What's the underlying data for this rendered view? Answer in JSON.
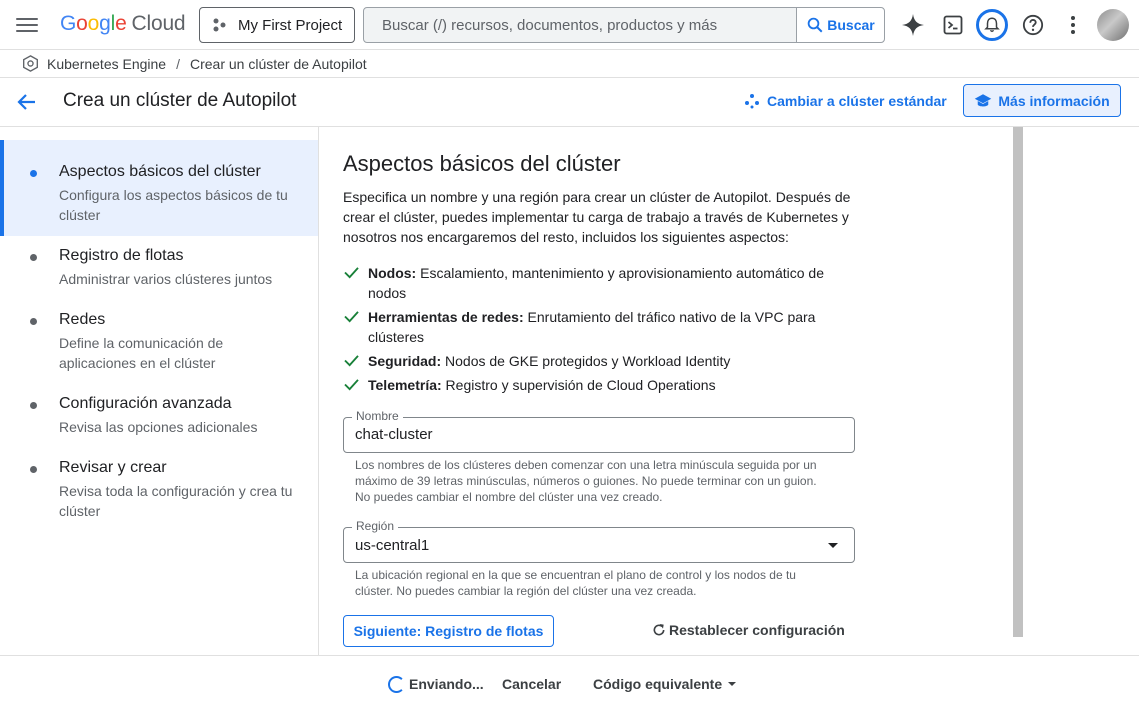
{
  "topbar": {
    "logo_google": "Google",
    "logo_cloud": "Cloud",
    "project_name": "My First Project",
    "search_placeholder": "Buscar (/) recursos, documentos, productos y más",
    "search_button": "Buscar",
    "icons": [
      "menu-icon",
      "gemini-sparkle-icon",
      "cloud-shell-icon",
      "notifications-bell-icon",
      "help-icon",
      "more-vert-icon",
      "avatar"
    ]
  },
  "breadcrumb": {
    "product": "Kubernetes Engine",
    "separator": "/",
    "current": "Crear un clúster de Autopilot"
  },
  "header": {
    "title": "Crea un clúster de Autopilot",
    "switch_link": "Cambiar a clúster estándar",
    "learn_more": "Más información"
  },
  "steps": [
    {
      "title": "Aspectos básicos del clúster",
      "desc": "Configura los aspectos básicos de tu clúster",
      "active": true
    },
    {
      "title": "Registro de flotas",
      "desc": "Administrar varios clústeres juntos",
      "active": false
    },
    {
      "title": "Redes",
      "desc": "Define la comunicación de aplicaciones en el clúster",
      "active": false
    },
    {
      "title": "Configuración avanzada",
      "desc": "Revisa las opciones adicionales",
      "active": false
    },
    {
      "title": "Revisar y crear",
      "desc": "Revisa toda la configuración y crea tu clúster",
      "active": false
    }
  ],
  "main": {
    "heading": "Aspectos básicos del clúster",
    "intro": "Especifica un nombre y una región para crear un clúster de Autopilot. Después de crear el clúster, puedes implementar tu carga de trabajo a través de Kubernetes y nosotros nos encargaremos del resto, incluidos los siguientes aspectos:",
    "features": [
      {
        "label": "Nodos:",
        "text": " Escalamiento, mantenimiento y aprovisionamiento automático de nodos"
      },
      {
        "label": "Herramientas de redes:",
        "text": " Enrutamiento del tráfico nativo de la VPC para clústeres"
      },
      {
        "label": "Seguridad:",
        "text": " Nodos de GKE protegidos y Workload Identity"
      },
      {
        "label": "Telemetría:",
        "text": " Registro y supervisión de Cloud Operations"
      }
    ],
    "name_field": {
      "label": "Nombre",
      "value": "chat-cluster",
      "hint": "Los nombres de los clústeres deben comenzar con una letra minúscula seguida por un máximo de 39 letras minúsculas, números o guiones. No puede terminar con un guion. No puedes cambiar el nombre del clúster una vez creado."
    },
    "region_field": {
      "label": "Región",
      "value": "us-central1",
      "hint": "La ubicación regional en la que se encuentran el plano de control y los nodos de tu clúster. No puedes cambiar la región del clúster una vez creada."
    },
    "next_button": "Siguiente: Registro de flotas",
    "reset_button": "Restablecer configuración"
  },
  "footer": {
    "status": "Enviando...",
    "cancel": "Cancelar",
    "equivalent_code": "Código equivalente"
  },
  "colors": {
    "accent": "#1a73e8",
    "active_bg": "#e8f0fe",
    "check": "#188038"
  }
}
